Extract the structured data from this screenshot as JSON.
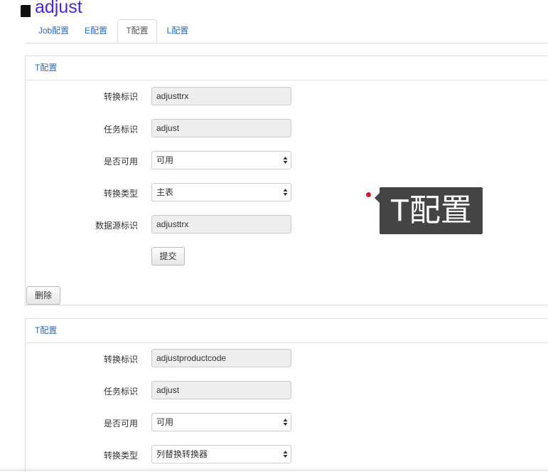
{
  "header": {
    "title": "adjust",
    "icon": "book-icon"
  },
  "tabs": [
    {
      "label": "Job配置",
      "active": false
    },
    {
      "label": "E配置",
      "active": false
    },
    {
      "label": "T配置",
      "active": true
    },
    {
      "label": "L配置",
      "active": false
    }
  ],
  "panels": [
    {
      "title": "T配置",
      "fields": {
        "convert_id": {
          "label": "转换标识",
          "value": "adjusttrx"
        },
        "task_id": {
          "label": "任务标识",
          "value": "adjust"
        },
        "enabled": {
          "label": "是否可用",
          "value": "可用"
        },
        "convert_type": {
          "label": "转换类型",
          "value": "主表"
        },
        "datasource_id": {
          "label": "数据源标识",
          "value": "adjusttrx"
        }
      },
      "submit_label": "提交",
      "delete_label": "删除"
    },
    {
      "title": "T配置",
      "fields": {
        "convert_id": {
          "label": "转换标识",
          "value": "adjustproductcode"
        },
        "task_id": {
          "label": "任务标识",
          "value": "adjust"
        },
        "enabled": {
          "label": "是否可用",
          "value": "可用"
        },
        "convert_type": {
          "label": "转换类型",
          "value": "列替换转换器"
        }
      }
    }
  ],
  "tooltip": {
    "text": "T配置"
  },
  "colors": {
    "link": "#2a6ab6",
    "title": "#4a24d8",
    "tooltip_bg": "#444444",
    "dot": "#e0182f"
  }
}
